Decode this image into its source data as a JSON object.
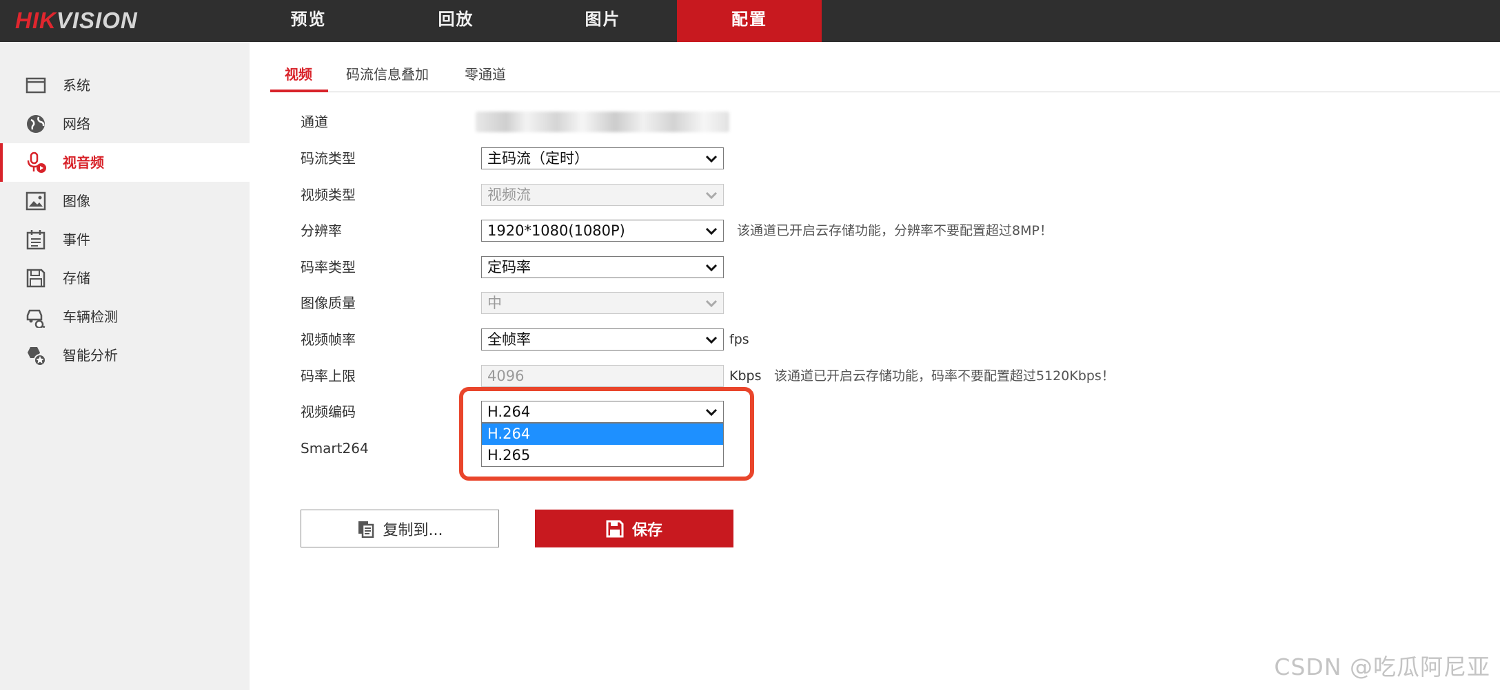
{
  "brand": {
    "logo_red": "HIK",
    "logo_grey": "VISION"
  },
  "nav": {
    "items": [
      "预览",
      "回放",
      "图片",
      "配置"
    ],
    "active": "配置"
  },
  "sidebar": {
    "items": [
      {
        "label": "系统",
        "icon": "monitor-icon"
      },
      {
        "label": "网络",
        "icon": "globe-icon"
      },
      {
        "label": "视音频",
        "icon": "microphone-icon"
      },
      {
        "label": "图像",
        "icon": "image-icon"
      },
      {
        "label": "事件",
        "icon": "calendar-icon"
      },
      {
        "label": "存储",
        "icon": "floppy-icon"
      },
      {
        "label": "车辆检测",
        "icon": "vehicle-detect-icon"
      },
      {
        "label": "智能分析",
        "icon": "smart-analysis-icon"
      }
    ],
    "active": "视音频"
  },
  "tabs": {
    "items": [
      "视频",
      "码流信息叠加",
      "零通道"
    ],
    "active": "视频"
  },
  "form": {
    "channel": {
      "label": "通道"
    },
    "stream_type": {
      "label": "码流类型",
      "value": "主码流（定时）"
    },
    "video_type": {
      "label": "视频类型",
      "value": "视频流"
    },
    "resolution": {
      "label": "分辨率",
      "value": "1920*1080(1080P)",
      "hint": "该通道已开启云存储功能，分辨率不要配置超过8MP！"
    },
    "bitrate_type": {
      "label": "码率类型",
      "value": "定码率"
    },
    "image_quality": {
      "label": "图像质量",
      "value": "中"
    },
    "frame_rate": {
      "label": "视频帧率",
      "value": "全帧率",
      "unit": "fps"
    },
    "max_bitrate": {
      "label": "码率上限",
      "value": "4096",
      "unit": "Kbps",
      "hint": "该通道已开启云存储功能，码率不要配置超过5120Kbps！"
    },
    "video_encoding": {
      "label": "视频编码",
      "value": "H.264",
      "options": [
        "H.264",
        "H.265"
      ],
      "selected": "H.264"
    },
    "smart264": {
      "label": "Smart264"
    }
  },
  "buttons": {
    "copy": "复制到...",
    "save": "保存"
  },
  "colors": {
    "accent": "#c8191f",
    "topbar": "#2f2f2f",
    "sidebar": "#f0f0f0",
    "highlight": "#e9452b",
    "selected_option": "#1e90ff"
  },
  "watermark": "CSDN @吃瓜阿尼亚"
}
